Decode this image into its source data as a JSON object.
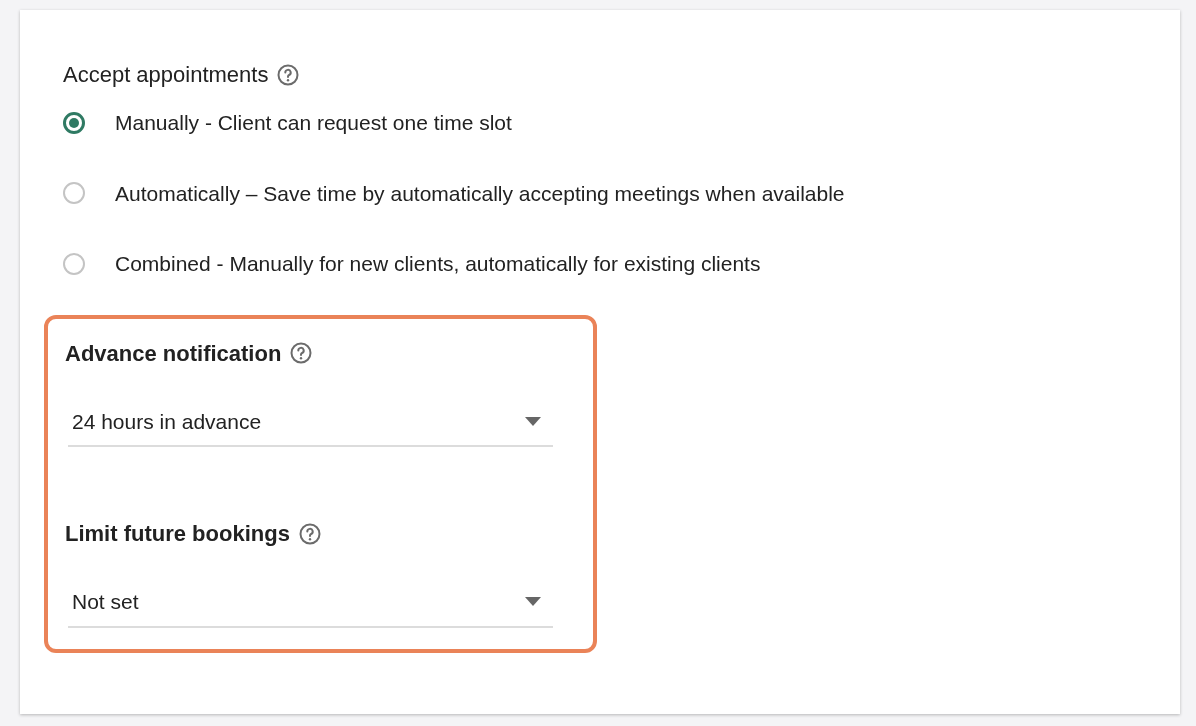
{
  "accept_appointments": {
    "label": "Accept appointments",
    "options": [
      {
        "label": "Manually - Client can request one time slot",
        "selected": true
      },
      {
        "label": "Automatically – Save time by automatically accepting meetings when available",
        "selected": false
      },
      {
        "label": "Combined - Manually for new clients, automatically for existing clients",
        "selected": false
      }
    ]
  },
  "highlighted_section": {
    "highlighted": true,
    "fields": [
      {
        "label": "Advance notification",
        "value": "24 hours in advance"
      },
      {
        "label": "Limit future bookings",
        "value": "Not set"
      }
    ]
  }
}
